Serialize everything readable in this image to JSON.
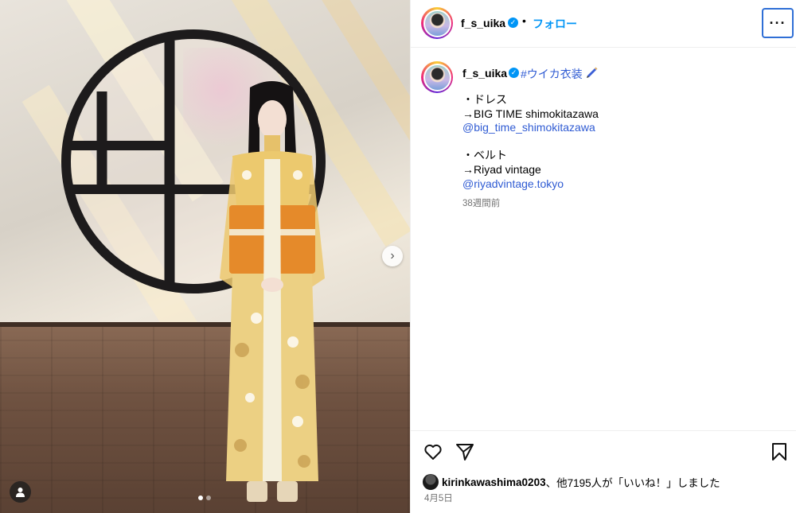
{
  "post": {
    "username": "f_s_uika",
    "verified_mark": "✓",
    "separator": "•",
    "follow_label": "フォロー",
    "more_label": "···"
  },
  "caption": {
    "username": "f_s_uika",
    "hashtag": "#ウイカ衣装",
    "lines": [
      "・ドレス",
      "→BIG TIME shimokitazawa",
      "@big_time_shimokitazawa",
      "",
      "・ベルト",
      "→Riyad vintage",
      "@riyadvintage.tokyo"
    ],
    "relative_time": "38週間前"
  },
  "engagement": {
    "liker": "kirinkawashima0203",
    "likes_text": "、他7195人が「いいね！」しました",
    "date": "4月5日"
  },
  "carousel": {
    "current_index": 1,
    "total": 2,
    "next_glyph": "›"
  },
  "icons": {
    "like": "heart-icon",
    "share": "paper-plane-icon",
    "save": "bookmark-icon",
    "tag": "user-tag-icon",
    "pen": "pen-icon"
  },
  "colors": {
    "link": "#2f5bd3",
    "verified": "#0095f6",
    "muted": "#737373"
  }
}
